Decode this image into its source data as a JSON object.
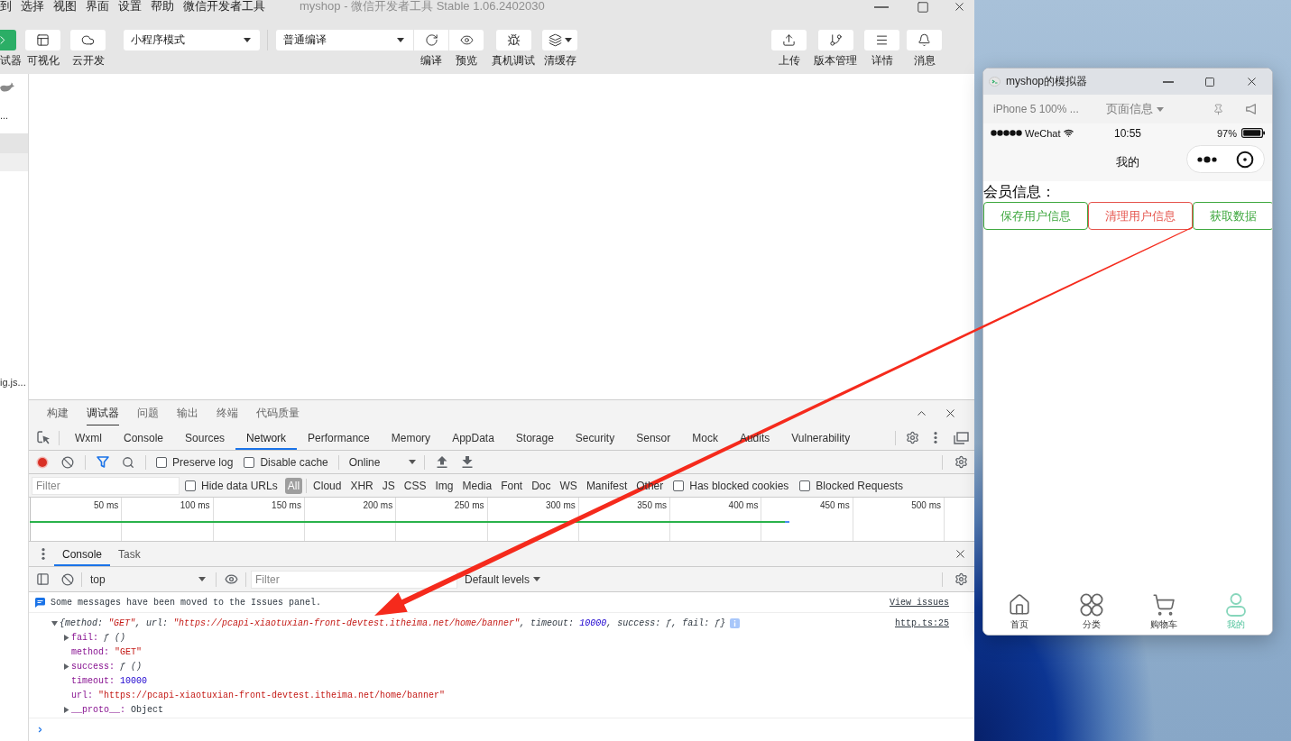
{
  "menu_bar": {
    "items": [
      "到",
      "选择",
      "视图",
      "界面",
      "设置",
      "帮助",
      "微信开发者工具"
    ],
    "title": "myshop - 微信开发者工具 Stable 1.06.2402030"
  },
  "toolbar": {
    "left_buttons": [
      {
        "label": "试器",
        "kind": "primary"
      },
      {
        "label": "可视化",
        "kind": "plain"
      },
      {
        "label": "云开发",
        "kind": "plain"
      }
    ],
    "mode_select": "小程序模式",
    "compile_select": "普通编译",
    "compile_buttons": [
      "编译",
      "预览"
    ],
    "debug_buttons": [
      "真机调试",
      "清缓存"
    ],
    "right_buttons": [
      "上传",
      "版本管理",
      "详情",
      "消息"
    ]
  },
  "sidebar": {
    "items": [
      "...",
      "ig.js..."
    ]
  },
  "devtools": {
    "panel_tabs": [
      {
        "label": "构建",
        "selected": false
      },
      {
        "label": "调试器",
        "selected": true
      },
      {
        "label": "问题",
        "selected": false
      },
      {
        "label": "输出",
        "selected": false
      },
      {
        "label": "终端",
        "selected": false
      },
      {
        "label": "代码质量",
        "selected": false
      }
    ],
    "tool_tabs": [
      {
        "label": "Wxml",
        "selected": false
      },
      {
        "label": "Console",
        "selected": false
      },
      {
        "label": "Sources",
        "selected": false
      },
      {
        "label": "Network",
        "selected": true
      },
      {
        "label": "Performance",
        "selected": false
      },
      {
        "label": "Memory",
        "selected": false
      },
      {
        "label": "AppData",
        "selected": false
      },
      {
        "label": "Storage",
        "selected": false
      },
      {
        "label": "Security",
        "selected": false
      },
      {
        "label": "Sensor",
        "selected": false
      },
      {
        "label": "Mock",
        "selected": false
      },
      {
        "label": "Audits",
        "selected": false
      },
      {
        "label": "Vulnerability",
        "selected": false
      }
    ],
    "network": {
      "recording": true,
      "preserve_log": {
        "label": "Preserve log",
        "checked": false
      },
      "disable_cache": {
        "label": "Disable cache",
        "checked": false
      },
      "throttling": "Online",
      "filter": {
        "placeholder": "Filter"
      },
      "hide_data_urls": {
        "label": "Hide data URLs",
        "checked": false
      },
      "type_filters": [
        {
          "label": "All",
          "selected": true
        },
        {
          "label": "Cloud",
          "selected": false
        },
        {
          "label": "XHR",
          "selected": false
        },
        {
          "label": "JS",
          "selected": false
        },
        {
          "label": "CSS",
          "selected": false
        },
        {
          "label": "Img",
          "selected": false
        },
        {
          "label": "Media",
          "selected": false
        },
        {
          "label": "Font",
          "selected": false
        },
        {
          "label": "Doc",
          "selected": false
        },
        {
          "label": "WS",
          "selected": false
        },
        {
          "label": "Manifest",
          "selected": false
        },
        {
          "label": "Other",
          "selected": false
        }
      ],
      "has_blocked_cookies": {
        "label": "Has blocked cookies",
        "checked": false
      },
      "blocked_requests": {
        "label": "Blocked Requests",
        "checked": false
      },
      "timeline_ticks": [
        "50 ms",
        "100 ms",
        "150 ms",
        "200 ms",
        "250 ms",
        "300 ms",
        "350 ms",
        "400 ms",
        "450 ms",
        "500 ms"
      ]
    },
    "console": {
      "tabs": [
        {
          "label": "Console",
          "selected": true
        },
        {
          "label": "Task",
          "selected": false
        }
      ],
      "context": "top",
      "filter": {
        "placeholder": "Filter"
      },
      "levels": "Default levels",
      "messages": [
        {
          "kind": "info",
          "text": "Some messages have been moved to the Issues panel.",
          "link": "View issues"
        },
        {
          "kind": "object",
          "expanded": true,
          "summary": [
            {
              "kind": "plain",
              "text": "{method: "
            },
            {
              "kind": "string",
              "text": "\"GET\""
            },
            {
              "kind": "plain",
              "text": ", url: "
            },
            {
              "kind": "string",
              "text": "\"https://pcapi-xiaotuxian-front-devtest.itheima.net/home/banner\""
            },
            {
              "kind": "plain",
              "text": ", timeout: "
            },
            {
              "kind": "number",
              "text": "10000"
            },
            {
              "kind": "plain",
              "text": ", success: ƒ, fail: ƒ}"
            }
          ],
          "source": "http.ts:25",
          "properties": [
            {
              "key": "fail:",
              "value": "ƒ ()",
              "kind": "function",
              "expanded": false
            },
            {
              "key": "method:",
              "value": "\"GET\"",
              "kind": "string"
            },
            {
              "key": "success:",
              "value": "ƒ ()",
              "kind": "function",
              "expanded": false
            },
            {
              "key": "timeout:",
              "value": "10000",
              "kind": "number"
            },
            {
              "key": "url:",
              "value": "\"https://pcapi-xiaotuxian-front-devtest.itheima.net/home/banner\"",
              "kind": "string"
            },
            {
              "key": "__proto__:",
              "value": "Object",
              "kind": "object",
              "expanded": false
            }
          ]
        }
      ]
    }
  },
  "simulator": {
    "title": "myshop的模拟器",
    "device": "iPhone 5 100% ...",
    "page_info": "页面信息",
    "status_bar": {
      "carrier": "WeChat",
      "time": "10:55",
      "battery": "97%"
    },
    "nav_title": "我的",
    "page": {
      "heading": "会员信息：",
      "buttons": [
        {
          "label": "保存用户信息",
          "color": "#3fa83f"
        },
        {
          "label": "清理用户信息",
          "color": "#e5534b"
        },
        {
          "label": "获取数据",
          "color": "#3fa83f"
        }
      ]
    },
    "tab_bar": [
      {
        "label": "首页",
        "selected": false
      },
      {
        "label": "分类",
        "selected": false
      },
      {
        "label": "购物车",
        "selected": false
      },
      {
        "label": "我的",
        "selected": true
      }
    ]
  }
}
